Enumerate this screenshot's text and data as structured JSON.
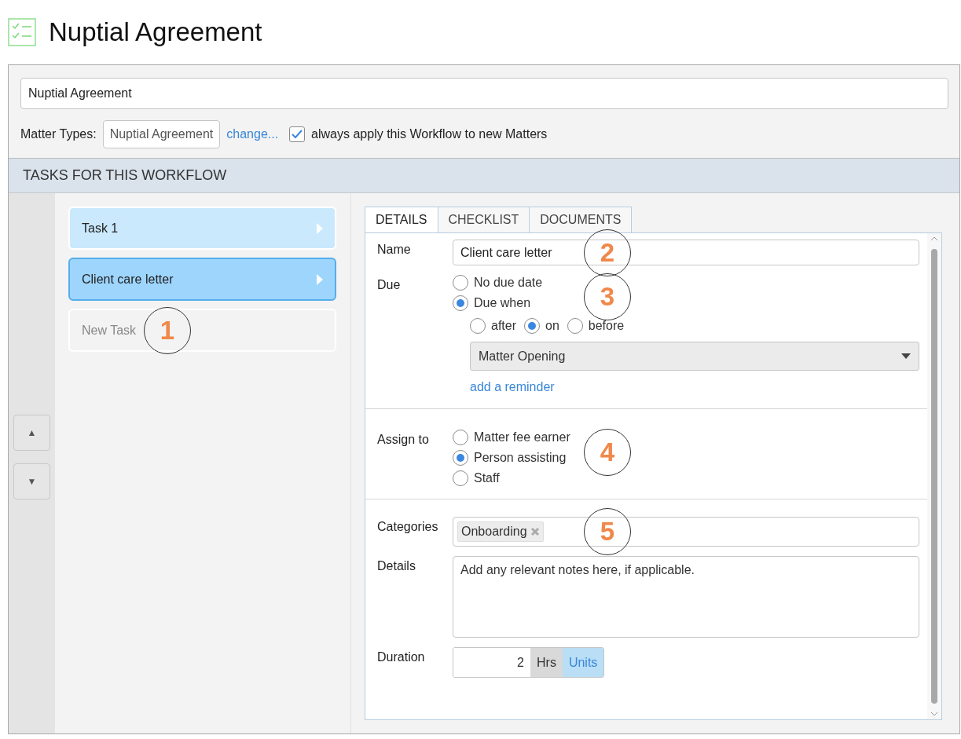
{
  "page_title": "Nuptial Agreement",
  "workflow_name": {
    "value": "Nuptial Agreement"
  },
  "matter_types": {
    "label": "Matter Types:",
    "value": "Nuptial Agreement",
    "change_link": "change...",
    "always_apply": {
      "label": "always apply this Workflow to new Matters",
      "checked": true
    }
  },
  "tasks_header": "TASKS FOR THIS WORKFLOW",
  "move_buttons": [
    {
      "label": "▲"
    },
    {
      "label": "▼"
    }
  ],
  "tasks": [
    {
      "label": "Task 1",
      "kind": "task",
      "selected": false
    },
    {
      "label": "Client care letter",
      "kind": "task",
      "selected": true
    },
    {
      "label": "New Task",
      "kind": "new",
      "selected": false,
      "callout": "1"
    }
  ],
  "tabs": [
    {
      "label": "DETAILS",
      "selected": true
    },
    {
      "label": "CHECKLIST",
      "selected": false
    },
    {
      "label": "DOCUMENTS",
      "selected": false
    }
  ],
  "details": {
    "name": {
      "label": "Name",
      "value": "Client care letter",
      "callout": "2"
    },
    "due": {
      "label": "Due",
      "callout": "3",
      "options": [
        {
          "label": "No due date",
          "selected": false
        },
        {
          "label": "Due when",
          "selected": true
        }
      ],
      "relation": [
        {
          "label": "after",
          "selected": false
        },
        {
          "label": "on",
          "selected": true
        },
        {
          "label": "before",
          "selected": false
        }
      ],
      "event": "Matter Opening",
      "reminder_link": "add a reminder"
    },
    "assign": {
      "label": "Assign to",
      "callout": "4",
      "options": [
        {
          "label": "Matter fee earner",
          "selected": false
        },
        {
          "label": "Person assisting",
          "selected": true
        },
        {
          "label": "Staff",
          "selected": false
        }
      ]
    },
    "categories": {
      "label": "Categories",
      "callout": "5",
      "tags": [
        "Onboarding"
      ]
    },
    "notes": {
      "label": "Details",
      "value": "Add any relevant notes here, if applicable."
    },
    "duration": {
      "label": "Duration",
      "value": "2",
      "units": [
        {
          "label": "Hrs",
          "selected": false
        },
        {
          "label": "Units",
          "selected": true
        }
      ]
    }
  }
}
